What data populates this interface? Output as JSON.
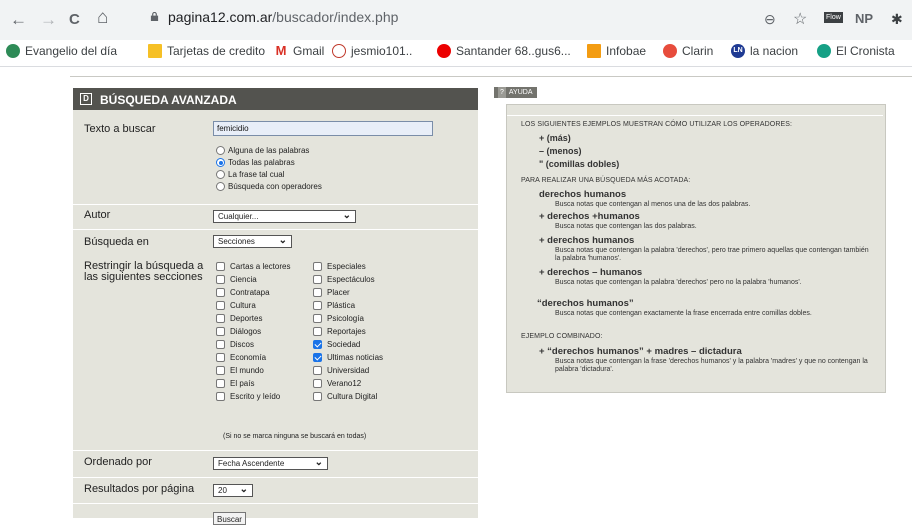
{
  "browser": {
    "nav": {
      "back": "←",
      "forward": "→",
      "reload": "C",
      "home": "⌂"
    },
    "url_host": "pagina12.com.ar",
    "url_path": "/buscador/index.php",
    "toolbar_icons": {
      "zoom": "⊖",
      "star": "☆",
      "ext1": "Flow",
      "ext2": "NP",
      "puzzle": "✱"
    },
    "bookmarks": [
      {
        "label": "Evangelio del día",
        "color": "#2e8b57"
      },
      {
        "label": "Tarjetas de credito",
        "color": "#f6c026"
      },
      {
        "label": "Gmail",
        "color": "#d93025",
        "glyph": "M"
      },
      {
        "label": "jesmio101..",
        "color": "#c0392b"
      },
      {
        "label": "Santander 68..gus6...",
        "color": "#ec0000"
      },
      {
        "label": "Infobae",
        "color": "#f39c12"
      },
      {
        "label": "Clarin",
        "color": "#e74c3c"
      },
      {
        "label": "la nacion",
        "color": "#1f3a93",
        "glyph": "LN"
      },
      {
        "label": "El Cronista",
        "color": "#16a085"
      }
    ]
  },
  "search": {
    "title": "BÚSQUEDA AVANZADA",
    "text_label": "Texto a buscar",
    "text_value": "femicidio",
    "modes": [
      {
        "label": "Alguna de las palabras",
        "selected": false
      },
      {
        "label": "Todas las palabras",
        "selected": true
      },
      {
        "label": "La frase tal cual",
        "selected": false
      },
      {
        "label": "Búsqueda con operadores",
        "selected": false
      }
    ],
    "author_label": "Autor",
    "author_value": "Cualquier...",
    "search_in_label": "Búsqueda en",
    "search_in_value": "Secciones",
    "restrict_label_1": "Restringir la búsqueda a",
    "restrict_label_2": "las siguientes secciones",
    "sections_col1": [
      {
        "label": "Cartas a lectores",
        "checked": false
      },
      {
        "label": "Ciencia",
        "checked": false
      },
      {
        "label": "Contratapa",
        "checked": false
      },
      {
        "label": "Cultura",
        "checked": false
      },
      {
        "label": "Deportes",
        "checked": false
      },
      {
        "label": "Diálogos",
        "checked": false
      },
      {
        "label": "Discos",
        "checked": false
      },
      {
        "label": "Economía",
        "checked": false
      },
      {
        "label": "El mundo",
        "checked": false
      },
      {
        "label": "El país",
        "checked": false
      },
      {
        "label": "Escrito y leído",
        "checked": false
      }
    ],
    "sections_col2": [
      {
        "label": "Especiales",
        "checked": false
      },
      {
        "label": "Espectáculos",
        "checked": false
      },
      {
        "label": "Placer",
        "checked": false
      },
      {
        "label": "Plástica",
        "checked": false
      },
      {
        "label": "Psicología",
        "checked": false
      },
      {
        "label": "Reportajes",
        "checked": false
      },
      {
        "label": "Sociedad",
        "checked": true
      },
      {
        "label": "Ultimas noticias",
        "checked": true
      },
      {
        "label": "Universidad",
        "checked": false
      },
      {
        "label": "Verano12",
        "checked": false
      },
      {
        "label": "Cultura Digital",
        "checked": false
      }
    ],
    "sections_note": "(Si no se marca ninguna se buscará en todas)",
    "order_label": "Ordenado por",
    "order_value": "Fecha Ascendente",
    "per_page_label": "Resultados por página",
    "per_page_value": "20",
    "submit": "Buscar"
  },
  "help": {
    "badge_q": "?",
    "badge": "AYUDA",
    "intro": "LOS SIGUIENTES EJEMPLOS MUESTRAN CÓMO UTILIZAR LOS OPERADORES:",
    "operators": [
      "+ (más)",
      "– (menos)",
      "\" (comillas dobles)"
    ],
    "refine_title": "PARA REALIZAR UNA BÚSQUEDA MÁS ACOTADA:",
    "examples": [
      {
        "query": "derechos humanos",
        "desc": "Busca notas que contengan al menos una de las dos palabras."
      },
      {
        "query": "+ derechos +humanos",
        "desc": "Busca notas que contengan las dos palabras."
      },
      {
        "query": "+ derechos humanos",
        "desc": "Busca notas que contengan la palabra 'derechos', pero trae primero aquellas que contengan también la palabra 'humanos'."
      },
      {
        "query": "+ derechos – humanos",
        "desc": "Busca notas que contengan la palabra 'derechos' pero no la palabra 'humanos'."
      },
      {
        "query": "“derechos humanos”",
        "desc": "Busca notas que contengan exactamente la frase encerrada entre comillas dobles."
      }
    ],
    "combined_title": "EJEMPLO COMBINADO:",
    "combined_query": "+ “derechos humanos” + madres – dictadura",
    "combined_desc": "Busca notas que contengan la frase 'derechos humanos' y la palabra 'madres' y que no contengan la palabra 'dictadura'."
  }
}
